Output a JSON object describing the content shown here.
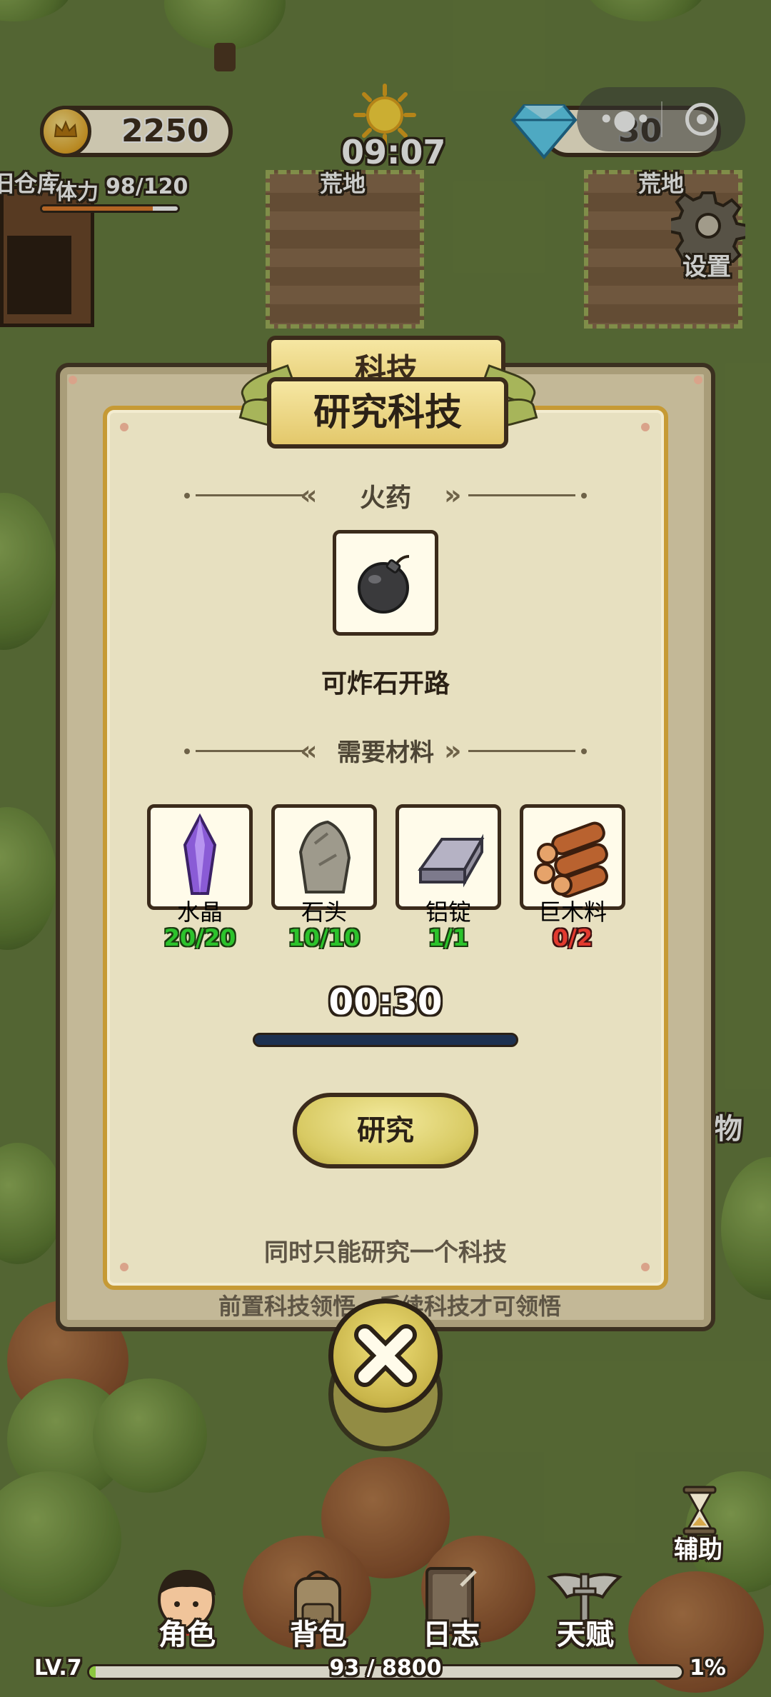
{
  "hud": {
    "coins": "2250",
    "stamina_label": "体力",
    "stamina_value": "98/120",
    "stamina_fraction": 0.817,
    "time": "09:07",
    "diamonds": "30",
    "settings_label": "设置",
    "warehouse_label": "旧仓库"
  },
  "world": {
    "field_left_label": "荒地",
    "field_right_label": "荒地",
    "side_label_right": "物"
  },
  "dialog": {
    "back_title": "科技",
    "title": "研究科技",
    "tech_name": "火药",
    "tech_icon": "bomb-icon",
    "tech_desc": "可炸石开路",
    "materials_header": "需要材料",
    "materials": [
      {
        "name": "水晶",
        "count": "20/20",
        "icon": "crystal-icon",
        "status": "ok"
      },
      {
        "name": "石头",
        "count": "10/10",
        "icon": "stone-icon",
        "status": "ok"
      },
      {
        "name": "铝锭",
        "count": "1/1",
        "icon": "aluminum-ingot-icon",
        "status": "ok"
      },
      {
        "name": "巨木料",
        "count": "0/2",
        "icon": "logs-icon",
        "status": "lack"
      }
    ],
    "timer": "00:30",
    "progress_fraction": 0,
    "research_button": "研究",
    "note": "同时只能研究一个科技",
    "back_note": "前置科技领悟，后续科技才可领悟"
  },
  "nav": {
    "assist_label": "辅助",
    "items": [
      {
        "label": "角色",
        "icon": "character-icon"
      },
      {
        "label": "背包",
        "icon": "backpack-icon"
      },
      {
        "label": "日志",
        "icon": "journal-icon"
      },
      {
        "label": "天赋",
        "icon": "talent-icon"
      }
    ],
    "level": "LV.7",
    "xp": "93 / 8800",
    "xp_percent": "1%",
    "xp_fraction": 0.011
  },
  "colors": {
    "ok_green": "#2cc32c",
    "lack_red": "#e23a2f",
    "panel_gold": "#c69a35"
  }
}
